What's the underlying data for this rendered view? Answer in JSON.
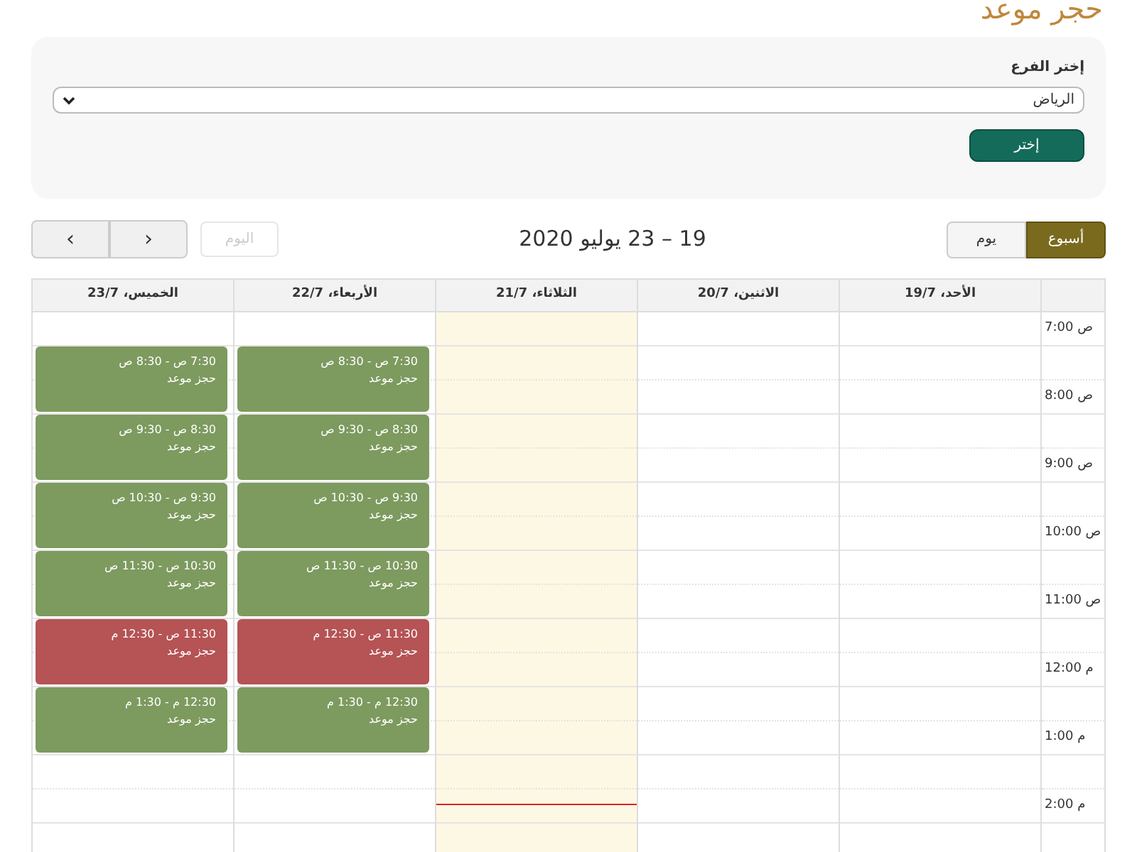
{
  "page_title": "حجر موعد",
  "branch_form": {
    "label": "إختر الفرع",
    "value": "الرياض",
    "button": "إختر"
  },
  "toolbar": {
    "views": [
      {
        "label": "أسبوع",
        "selected": true
      },
      {
        "label": "يوم",
        "selected": false
      }
    ],
    "range_title": "19 – 23 يوليو 2020",
    "today_button": {
      "label": "اليوم",
      "disabled": true
    },
    "nav_buttons": [
      "‹",
      "›"
    ]
  },
  "calendar": {
    "time_labels": [
      "ص 7:00",
      "ص 8:00",
      "ص 9:00",
      "ص 10:00",
      "ص 11:00",
      "م 12:00",
      "م 1:00",
      "م 2:00"
    ],
    "days": [
      {
        "label": "الأحد، 19/7",
        "today": false
      },
      {
        "label": "الاثنين، 20/7",
        "today": false
      },
      {
        "label": "الثلاثاء، 21/7",
        "today": true
      },
      {
        "label": "الأربعاء، 22/7",
        "today": false,
        "events": [
          {
            "time": "7:30 ص - 8:30 ص",
            "title": "حجز موعد",
            "color": "#7d9a5f"
          },
          {
            "time": "8:30 ص - 9:30 ص",
            "title": "حجز موعد",
            "color": "#7d9a5f"
          },
          {
            "time": "9:30 ص - 10:30 ص",
            "title": "حجز موعد",
            "color": "#7d9a5f"
          },
          {
            "time": "10:30 ص - 11:30 ص",
            "title": "حجز موعد",
            "color": "#7d9a5f"
          },
          {
            "time": "11:30 ص - 12:30 م",
            "title": "حجز موعد",
            "color": "#b55355"
          },
          {
            "time": "12:30 م - 1:30 م",
            "title": "حجز موعد",
            "color": "#7d9a5f"
          }
        ]
      },
      {
        "label": "الخميس، 23/7",
        "today": false,
        "events": [
          {
            "time": "7:30 ص - 8:30 ص",
            "title": "حجز موعد",
            "color": "#7d9a5f"
          },
          {
            "time": "8:30 ص - 9:30 ص",
            "title": "حجز موعد",
            "color": "#7d9a5f"
          },
          {
            "time": "9:30 ص - 10:30 ص",
            "title": "حجز موعد",
            "color": "#7d9a5f"
          },
          {
            "time": "10:30 ص - 11:30 ص",
            "title": "حجز موعد",
            "color": "#7d9a5f"
          },
          {
            "time": "11:30 ص - 12:30 م",
            "title": "حجز موعد",
            "color": "#b55355"
          },
          {
            "time": "12:30 م - 1:30 م",
            "title": "حجز موعد",
            "color": "#7d9a5f"
          }
        ]
      }
    ]
  }
}
